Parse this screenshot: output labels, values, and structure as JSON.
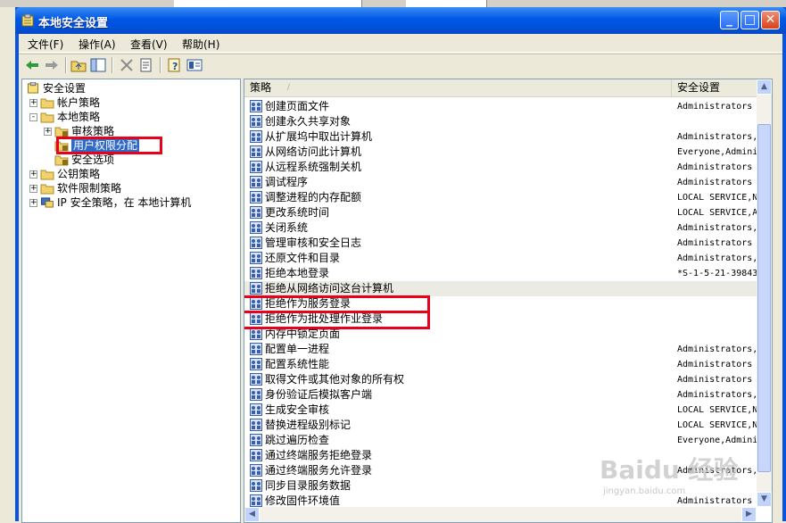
{
  "window": {
    "title": "本地安全设置"
  },
  "menubar": {
    "items": [
      "文件(F)",
      "操作(A)",
      "查看(V)",
      "帮助(H)"
    ]
  },
  "toolbar": {
    "buttons": [
      "back-icon",
      "forward-icon",
      "up-folder-icon",
      "show-tree-icon",
      "delete-icon",
      "export-icon",
      "help-icon",
      "properties-icon"
    ]
  },
  "tree": [
    {
      "label": "安全设置",
      "level": 0,
      "expander": ""
    },
    {
      "label": "帐户策略",
      "level": 1,
      "expander": "+"
    },
    {
      "label": "本地策略",
      "level": 1,
      "expander": "-"
    },
    {
      "label": "审核策略",
      "level": 2,
      "expander": "+"
    },
    {
      "label": "用户权限分配",
      "level": 2,
      "expander": "",
      "selected": true
    },
    {
      "label": "安全选项",
      "level": 2,
      "expander": ""
    },
    {
      "label": "公钥策略",
      "level": 1,
      "expander": "+"
    },
    {
      "label": "软件限制策略",
      "level": 1,
      "expander": "+"
    },
    {
      "label": "IP 安全策略，在 本地计算机",
      "level": 1,
      "expander": "+"
    }
  ],
  "list": {
    "headers": {
      "policy": "策略",
      "setting": "安全设置"
    },
    "rows": [
      {
        "name": "创建页面文件",
        "value": "Administrators"
      },
      {
        "name": "创建永久共享对象",
        "value": ""
      },
      {
        "name": "从扩展坞中取出计算机",
        "value": "Administrators,..."
      },
      {
        "name": "从网络访问此计算机",
        "value": "Everyone,Admini..."
      },
      {
        "name": "从远程系统强制关机",
        "value": "Administrators"
      },
      {
        "name": "调试程序",
        "value": "Administrators"
      },
      {
        "name": "调整进程的内存配额",
        "value": "LOCAL SERVICE,N..."
      },
      {
        "name": "更改系统时间",
        "value": "LOCAL SERVICE,A..."
      },
      {
        "name": "关闭系统",
        "value": "Administrators,..."
      },
      {
        "name": "管理审核和安全日志",
        "value": "Administrators"
      },
      {
        "name": "还原文件和目录",
        "value": "Administrators,..."
      },
      {
        "name": "拒绝本地登录",
        "value": "*S-1-5-21-39843..."
      },
      {
        "name": "拒绝从网络访问这台计算机",
        "value": "",
        "highlight": true
      },
      {
        "name": "拒绝作为服务登录",
        "value": ""
      },
      {
        "name": "拒绝作为批处理作业登录",
        "value": ""
      },
      {
        "name": "内存中锁定页面",
        "value": ""
      },
      {
        "name": "配置单一进程",
        "value": "Administrators,..."
      },
      {
        "name": "配置系统性能",
        "value": "Administrators"
      },
      {
        "name": "取得文件或其他对象的所有权",
        "value": "Administrators"
      },
      {
        "name": "身份验证后模拟客户端",
        "value": "Administrators,..."
      },
      {
        "name": "生成安全审核",
        "value": "LOCAL SERVICE,N..."
      },
      {
        "name": "替换进程级别标记",
        "value": "LOCAL SERVICE,N..."
      },
      {
        "name": "跳过遍历检查",
        "value": "Everyone,Admini..."
      },
      {
        "name": "通过终端服务拒绝登录",
        "value": ""
      },
      {
        "name": "通过终端服务允许登录",
        "value": "Administrators,..."
      },
      {
        "name": "同步目录服务数据",
        "value": ""
      },
      {
        "name": "修改固件环境值",
        "value": "Administrators"
      }
    ]
  },
  "watermark": {
    "main": "Baidu 经验",
    "sub": "jingyan.baidu.com"
  }
}
